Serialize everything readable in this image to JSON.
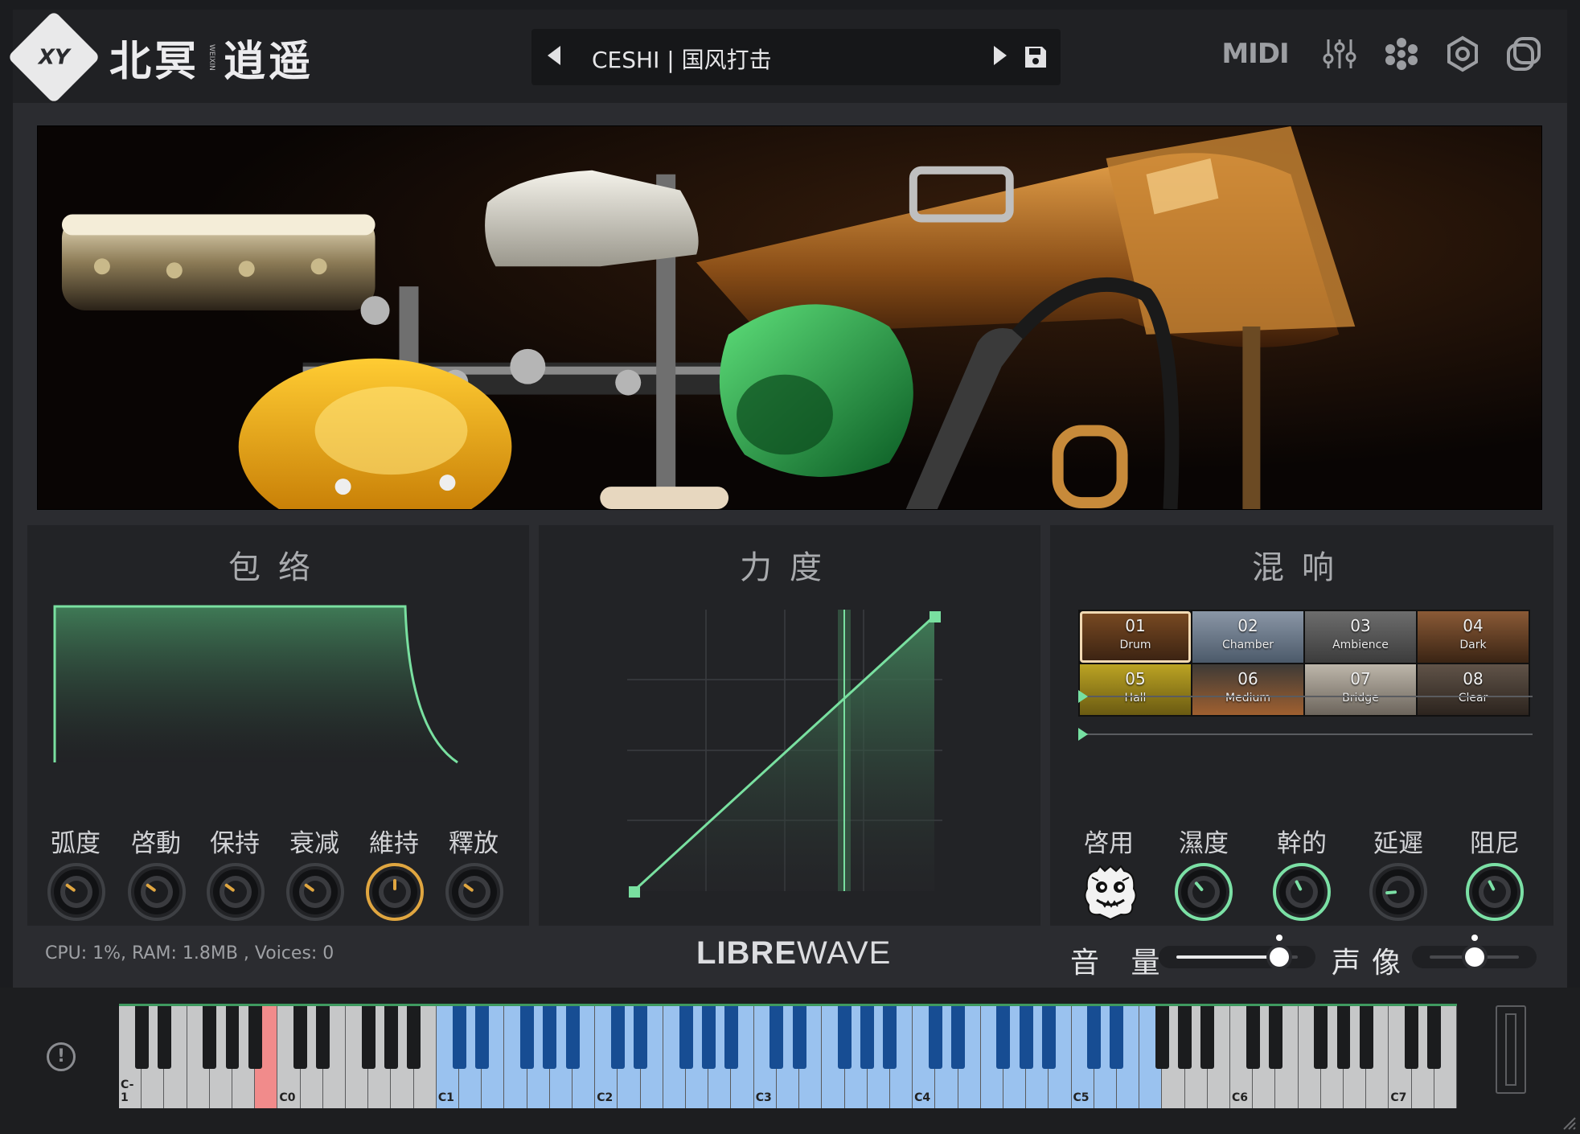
{
  "header": {
    "logo_mark": "XY",
    "logo_title_a": "北冥",
    "logo_title_sep": "WEIXIN",
    "logo_title_b": "逍遥",
    "preset_name": "CESHI | 国风打击",
    "midi_label": "MIDI"
  },
  "icons": {
    "prev": "triangle-left-icon",
    "next": "triangle-right-icon",
    "save": "floppy-icon",
    "mixer": "sliders-icon",
    "effects": "flower-icon",
    "settings": "hexagon-gear-icon",
    "layers": "layers-icon",
    "info": "info-icon"
  },
  "envelope": {
    "title": "包络",
    "knobs": [
      {
        "label": "弧度",
        "value": 0.3,
        "color": "#e0a640"
      },
      {
        "label": "啓動",
        "value": 0.3,
        "color": "#e0a640"
      },
      {
        "label": "保持",
        "value": 0.3,
        "color": "#e0a640"
      },
      {
        "label": "衰减",
        "value": 0.3,
        "color": "#e0a640"
      },
      {
        "label": "維持",
        "value": 0.5,
        "color": "#e0a640",
        "ring": true
      },
      {
        "label": "釋放",
        "value": 0.3,
        "color": "#e0a640"
      }
    ]
  },
  "velocity": {
    "title": "力度"
  },
  "reverb": {
    "title": "混响",
    "presets": [
      {
        "num": "01",
        "name": "Drum",
        "selected": true
      },
      {
        "num": "02",
        "name": "Chamber"
      },
      {
        "num": "03",
        "name": "Ambience"
      },
      {
        "num": "04",
        "name": "Dark"
      },
      {
        "num": "05",
        "name": "Hall"
      },
      {
        "num": "06",
        "name": "Medium"
      },
      {
        "num": "07",
        "name": "Bridge"
      },
      {
        "num": "08",
        "name": "Clear"
      }
    ],
    "slider_1": 0.0,
    "slider_2": 0.0,
    "enable_label": "啓用",
    "knobs": [
      {
        "label": "濕度",
        "value": 0.35,
        "ring": true
      },
      {
        "label": "幹的",
        "value": 0.4,
        "ring": true
      },
      {
        "label": "延遲",
        "value": 0.15,
        "ring": false
      },
      {
        "label": "阻尼",
        "value": 0.4,
        "ring": true
      }
    ],
    "accent": "#7be0a5"
  },
  "status": {
    "cpu_text": "CPU: 1%, RAM: 1.8MB , Voices: 0"
  },
  "brand": {
    "bold": "LIBRE",
    "light": "WAVE"
  },
  "volume": {
    "label": "音 量",
    "value": 0.85
  },
  "pan": {
    "label": "声像",
    "value": 0.5
  },
  "keyboard": {
    "octave_labels": [
      "C-1",
      "C0",
      "C1",
      "C2",
      "C3",
      "C4",
      "C5",
      "C6",
      "C7"
    ],
    "active_range_start_white": 14,
    "active_range_end_white": 45,
    "highlighted_white": 6,
    "accent": "#3f9a60"
  }
}
